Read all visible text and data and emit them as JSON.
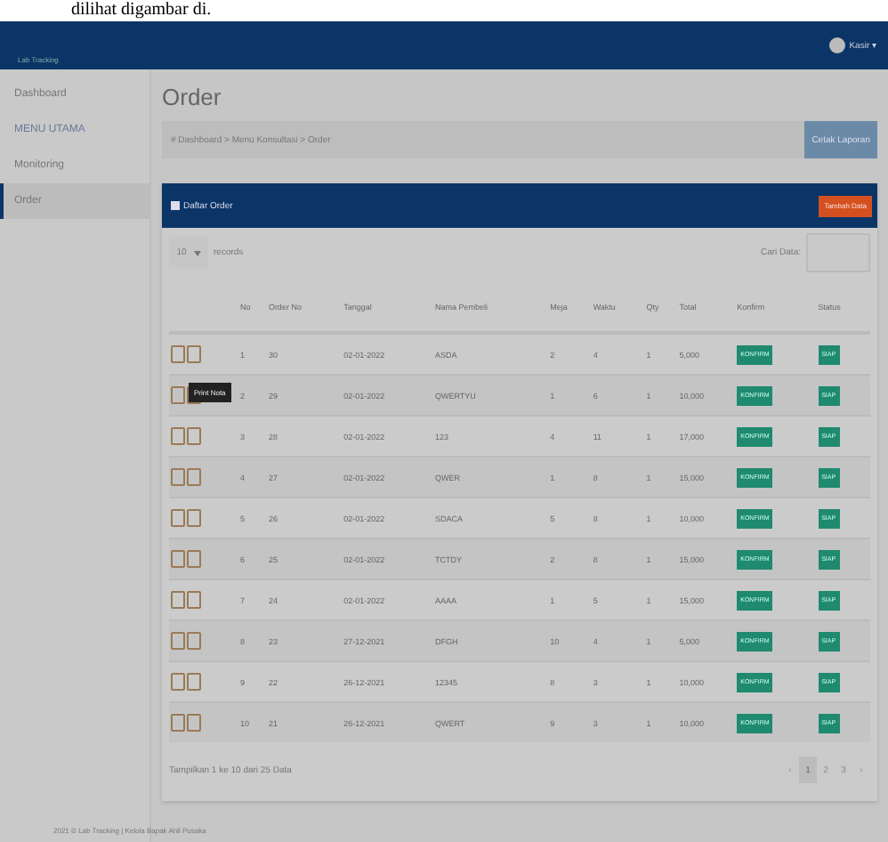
{
  "caption": "dilihat digambar di.",
  "navbar": {
    "brand": "Lab Tracking",
    "user": "Kasir ▾"
  },
  "sidebar": {
    "items": [
      {
        "label": "Dashboard",
        "kind": "link",
        "selected": false
      },
      {
        "label": "MENU UTAMA",
        "kind": "header",
        "selected": false
      },
      {
        "label": "Monitoring",
        "kind": "link",
        "selected": false
      },
      {
        "label": "Order",
        "kind": "link",
        "selected": true
      }
    ]
  },
  "page": {
    "title": "Order",
    "breadcrumb": "# Dashboard > Menu Konsultasi > Order",
    "action": "Cetak Laporan"
  },
  "panel": {
    "title": "Daftar Order",
    "action": "Tambah Data",
    "length": "10",
    "length_label": "records",
    "search_label": "Cari Data:"
  },
  "table": {
    "columns": [
      "No",
      "Order No",
      "Tanggal",
      "Nama Pembeli",
      "Meja",
      "Waktu",
      "Qty",
      "Total",
      "Konfirm",
      "Status"
    ],
    "rows": [
      {
        "cells": [
          "1",
          "30",
          "02-01-2022",
          "ASDA",
          "2",
          "4",
          "1",
          "5,000"
        ],
        "confirm": "KONFIRM",
        "status": "SIAP"
      },
      {
        "cells": [
          "2",
          "29",
          "02-01-2022",
          "QWERTYU",
          "1",
          "6",
          "1",
          "10,000"
        ],
        "confirm": "KONFIRM",
        "status": "SIAP",
        "tooltip": "Print Nota"
      },
      {
        "cells": [
          "3",
          "28",
          "02-01-2022",
          "123",
          "4",
          "11",
          "1",
          "17,000"
        ],
        "confirm": "KONFIRM",
        "status": "SIAP"
      },
      {
        "cells": [
          "4",
          "27",
          "02-01-2022",
          "QWER",
          "1",
          "8",
          "1",
          "15,000"
        ],
        "confirm": "KONFIRM",
        "status": "SIAP"
      },
      {
        "cells": [
          "5",
          "26",
          "02-01-2022",
          "SDACA",
          "5",
          "8",
          "1",
          "10,000"
        ],
        "confirm": "KONFIRM",
        "status": "SIAP"
      },
      {
        "cells": [
          "6",
          "25",
          "02-01-2022",
          "TCTDY",
          "2",
          "8",
          "1",
          "15,000"
        ],
        "confirm": "KONFIRM",
        "status": "SIAP"
      },
      {
        "cells": [
          "7",
          "24",
          "02-01-2022",
          "AAAA",
          "1",
          "5",
          "1",
          "15,000"
        ],
        "confirm": "KONFIRM",
        "status": "SIAP"
      },
      {
        "cells": [
          "8",
          "23",
          "27-12-2021",
          "DFGH",
          "10",
          "4",
          "1",
          "5,000"
        ],
        "confirm": "KONFIRM",
        "status": "SIAP"
      },
      {
        "cells": [
          "9",
          "22",
          "26-12-2021",
          "12345",
          "8",
          "3",
          "1",
          "10,000"
        ],
        "confirm": "KONFIRM",
        "status": "SIAP"
      },
      {
        "cells": [
          "10",
          "21",
          "26-12-2021",
          "QWERT",
          "9",
          "3",
          "1",
          "10,000"
        ],
        "confirm": "KONFIRM",
        "status": "SIAP"
      }
    ]
  },
  "info": "Tampilkan 1 ke 10 dari 25 Data",
  "pagination": [
    {
      "label": "‹",
      "selected": false
    },
    {
      "label": "1",
      "selected": true
    },
    {
      "label": "2",
      "selected": false
    },
    {
      "label": "3",
      "selected": false
    },
    {
      "label": "›",
      "selected": false
    }
  ],
  "footer": "2021 © Lab Tracking | Kelola Bapak Ahli Pusaka"
}
